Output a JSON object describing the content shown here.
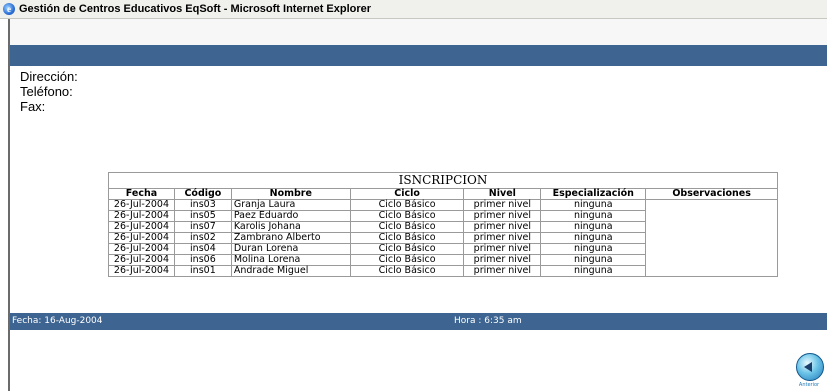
{
  "window": {
    "title": "Gestión de Centros Educativos EqSoft - Microsoft Internet Explorer"
  },
  "info": {
    "direccion_label": "Dirección:",
    "telefono_label": "Teléfono:",
    "fax_label": "Fax:"
  },
  "table": {
    "caption": "ISNCRIPCION",
    "headers": [
      "Fecha",
      "Código",
      "Nombre",
      "Ciclo",
      "Nivel",
      "Especialización",
      "Observaciones"
    ],
    "rows": [
      [
        "26-Jul-2004",
        "ins03",
        "Granja Laura",
        "Ciclo Básico",
        "primer nivel",
        "ninguna",
        ""
      ],
      [
        "26-Jul-2004",
        "ins05",
        "Paez Eduardo",
        "Ciclo Básico",
        "primer nivel",
        "ninguna",
        ""
      ],
      [
        "26-Jul-2004",
        "ins07",
        "Karolis Johana",
        "Ciclo Básico",
        "primer nivel",
        "ninguna",
        ""
      ],
      [
        "26-Jul-2004",
        "ins02",
        "Zambrano Alberto",
        "Ciclo Básico",
        "primer nivel",
        "ninguna",
        ""
      ],
      [
        "26-Jul-2004",
        "ins04",
        "Duran Lorena",
        "Ciclo Básico",
        "primer nivel",
        "ninguna",
        ""
      ],
      [
        "26-Jul-2004",
        "ins06",
        "Molina Lorena",
        "Ciclo Básico",
        "primer nivel",
        "ninguna",
        ""
      ],
      [
        "26-Jul-2004",
        "ins01",
        "Andrade Miguel",
        "Ciclo Básico",
        "primer nivel",
        "ninguna",
        ""
      ]
    ]
  },
  "footer": {
    "date": "Fecha: 16-Aug-2004",
    "time": "Hora : 6:35 am"
  },
  "back_button": {
    "icon": "back-arrow-icon",
    "label": "Anterior"
  },
  "colors": {
    "header_blue": "#3e6592"
  }
}
